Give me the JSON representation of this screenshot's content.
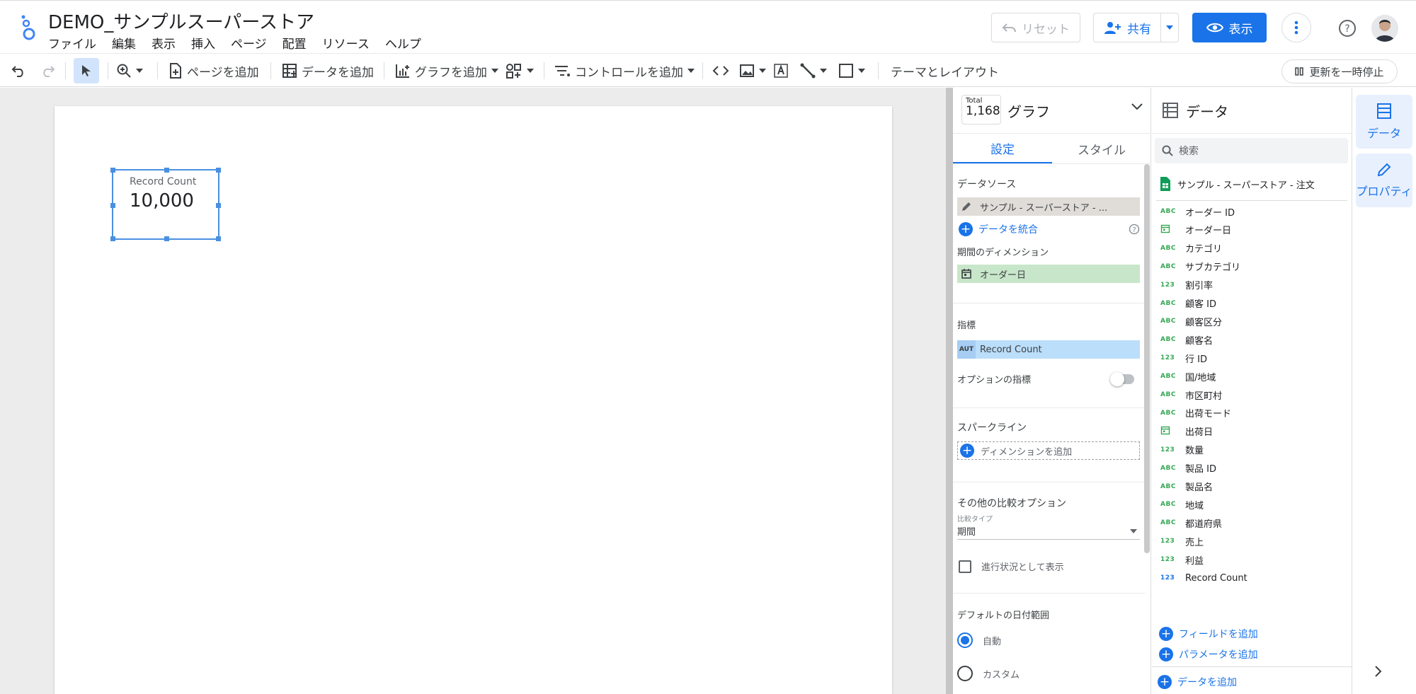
{
  "app": {
    "title": "DEMO_サンプルスーパーストア",
    "menu": [
      "ファイル",
      "編集",
      "表示",
      "挿入",
      "ページ",
      "配置",
      "リソース",
      "ヘルプ"
    ],
    "reset_label": "リセット",
    "share_label": "共有",
    "view_label": "表示",
    "accent": "#1a73e8"
  },
  "toolbar": {
    "add_page": "ページを追加",
    "add_data": "データを追加",
    "add_chart": "グラフを追加",
    "add_control": "コントロールを追加",
    "theme_layout": "テーマとレイアウト",
    "pause_updates": "更新を一時停止"
  },
  "scorecard": {
    "label": "Record Count",
    "value": "10,000"
  },
  "props": {
    "thumb_caption": "Total",
    "thumb_value": "1,168",
    "title": "グラフ",
    "tab_setup": "設定",
    "tab_style": "スタイル",
    "data_source_label": "データソース",
    "data_source_value": "サンプル - スーパーストア - ...",
    "blend_label": "データを統合",
    "date_dim_label": "期間のディメンション",
    "date_dim_value": "オーダー日",
    "metric_label": "指標",
    "metric_type": "AUT",
    "metric_value": "Record Count",
    "optional_metric_label": "オプションの指標",
    "sparkline_label": "スパークライン",
    "add_dimension": "ディメンションを追加",
    "comparison_label": "その他の比較オプション",
    "comparison_type_caption": "比較タイプ",
    "comparison_type_value": "期間",
    "progress_label": "進行状況として表示",
    "default_range_label": "デフォルトの日付範囲",
    "range_auto": "自動",
    "range_custom": "カスタム"
  },
  "data_panel": {
    "title": "データ",
    "search_placeholder": "検索",
    "source_name": "サンプル - スーパーストア - 注文",
    "fields": [
      {
        "type": "ABC",
        "name": "オーダー ID"
      },
      {
        "type": "DATE",
        "name": "オーダー日"
      },
      {
        "type": "ABC",
        "name": "カテゴリ"
      },
      {
        "type": "ABC",
        "name": "サブカテゴリ"
      },
      {
        "type": "123",
        "name": "割引率"
      },
      {
        "type": "ABC",
        "name": "顧客 ID"
      },
      {
        "type": "ABC",
        "name": "顧客区分"
      },
      {
        "type": "ABC",
        "name": "顧客名"
      },
      {
        "type": "123",
        "name": "行 ID"
      },
      {
        "type": "ABC",
        "name": "国/地域"
      },
      {
        "type": "ABC",
        "name": "市区町村"
      },
      {
        "type": "ABC",
        "name": "出荷モード"
      },
      {
        "type": "DATE",
        "name": "出荷日"
      },
      {
        "type": "123",
        "name": "数量"
      },
      {
        "type": "ABC",
        "name": "製品 ID"
      },
      {
        "type": "ABC",
        "name": "製品名"
      },
      {
        "type": "ABC",
        "name": "地域"
      },
      {
        "type": "ABC",
        "name": "都道府県"
      },
      {
        "type": "123",
        "name": "売上"
      },
      {
        "type": "123",
        "name": "利益"
      },
      {
        "type": "123",
        "name": "Record Count"
      }
    ],
    "add_field": "フィールドを追加",
    "add_parameter": "パラメータを追加",
    "add_data": "データを追加"
  },
  "rail": {
    "data_label": "データ",
    "props_label": "プロパティ"
  }
}
